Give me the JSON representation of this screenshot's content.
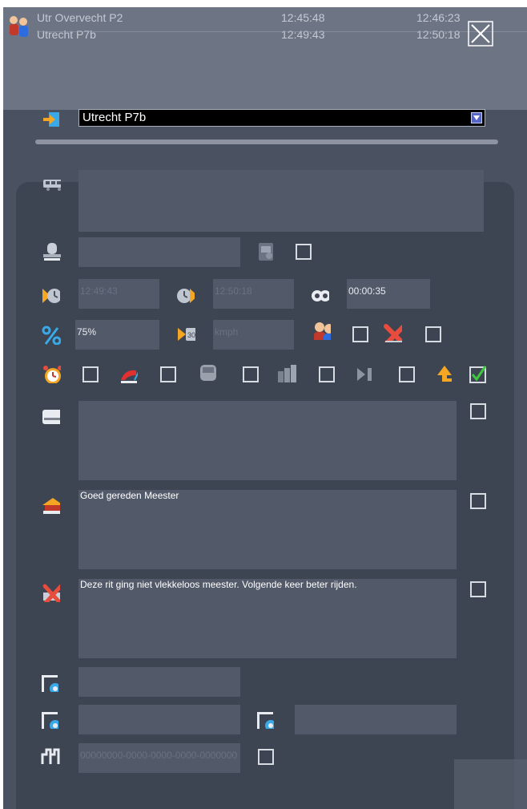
{
  "trips": [
    {
      "name": "Utr Overvecht P2",
      "start": "12:45:48",
      "end": "12:46:23"
    },
    {
      "name": "Utrecht P7b",
      "start": "12:49:43",
      "end": "12:50:18"
    }
  ],
  "location": {
    "selected": "Utrecht P7b"
  },
  "times": {
    "departure": "12:49:43",
    "arrival": "12:50:18",
    "duration": "00:00:35"
  },
  "percentage": "75%",
  "speed_placeholder": "kmph",
  "signal_code": "00000000-0000-0000-0000-0000000",
  "remarks": {
    "general": "",
    "praise": "Goed gereden Meester",
    "faults": "Deze rit ging niet vlekkeloos meester. Volgende keer beter rijden."
  },
  "checkboxes": {
    "status_done": true
  },
  "icons": [
    "location-icon",
    "train-icon",
    "driver-icon",
    "depart-clock-icon",
    "arrive-clock-icon",
    "duration-icon",
    "percent-icon",
    "speed-icon",
    "passengers-icon",
    "cancel-x-icon",
    "alarm-icon",
    "brake-icon",
    "unit-icon",
    "cars-icon",
    "skip-icon",
    "return-arrow-icon",
    "remarks-icon",
    "praise-icon",
    "fault-icon",
    "settings-icon",
    "signal-icon"
  ],
  "colors": {
    "accent": "#f5a623",
    "check": "#3ec83e",
    "panel": "#3d4452"
  }
}
